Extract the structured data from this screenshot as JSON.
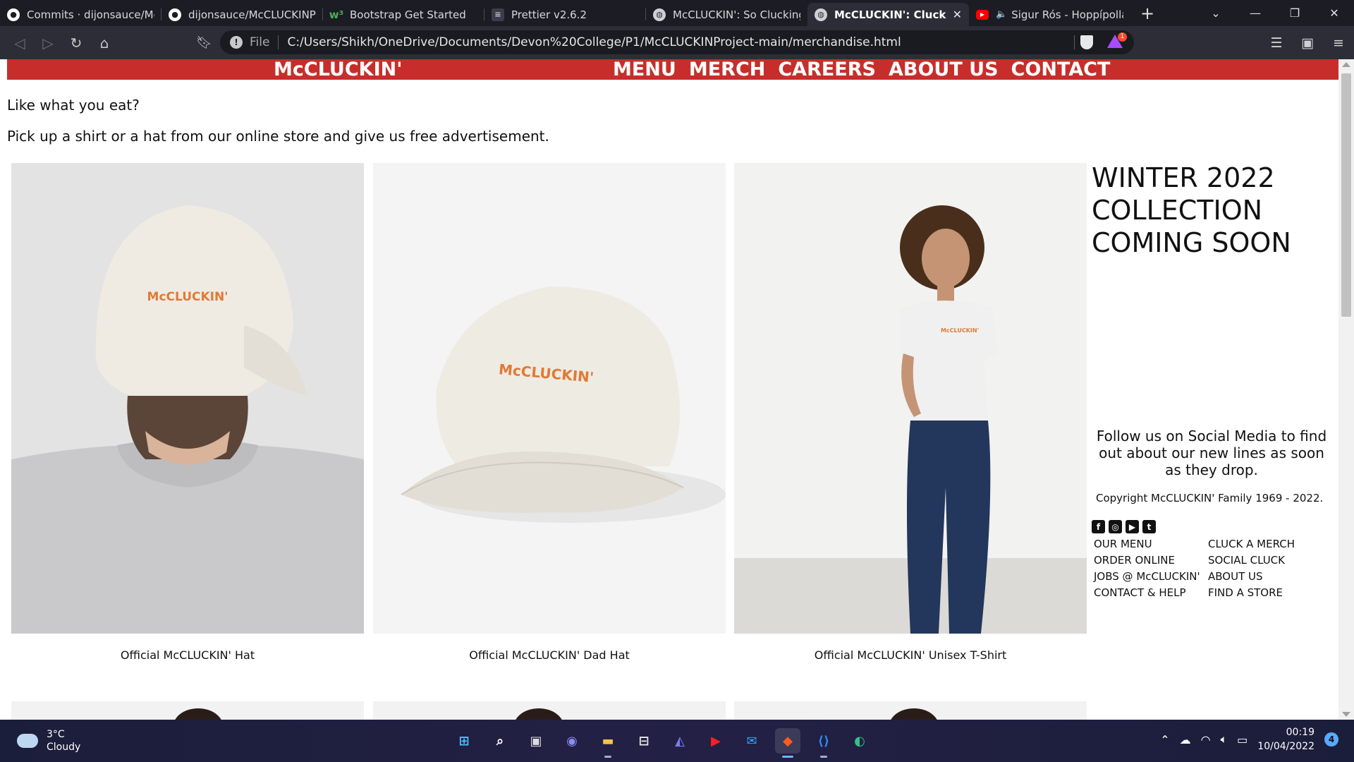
{
  "browser": {
    "tabs": [
      {
        "title": "Commits · dijonsauce/McCl",
        "icon": "github-icon"
      },
      {
        "title": "dijonsauce/McCLUCKINPro",
        "icon": "github-icon"
      },
      {
        "title": "Bootstrap Get Started",
        "icon": "w3schools-icon"
      },
      {
        "title": "Prettier v2.6.2",
        "icon": "prettier-icon"
      },
      {
        "title": "McCLUCKIN': So Clucking G",
        "icon": "globe-icon"
      },
      {
        "title": "McCLUCKIN': Cluck A M",
        "icon": "globe-icon"
      },
      {
        "title": "Sigur Rós - Hoppípolla",
        "icon": "youtube-icon"
      }
    ],
    "active_tab_index": 5,
    "address": {
      "scheme_label": "File",
      "url": "C:/Users/Shikh/OneDrive/Documents/Devon%20College/P1/McCLUCKINProject-main/merchandise.html"
    },
    "rewards_badge": "1"
  },
  "site": {
    "brand": "McCLUCKIN'",
    "nav": [
      "MENU",
      "MERCH",
      "CAREERS",
      "ABOUT US",
      "CONTACT"
    ],
    "intro_line1": "Like what you eat?",
    "intro_line2": "Pick up a shirt or a hat from our online store and give us free advertisement.",
    "products": [
      {
        "caption": "Official McCLUCKIN' Hat",
        "print": "McCLUCKIN'"
      },
      {
        "caption": "Official McCLUCKIN' Dad Hat",
        "print": "McCLUCKIN'"
      },
      {
        "caption": "Official McCLUCKIN' Unisex T-Shirt",
        "print": "McCLUCKIN'"
      }
    ],
    "sidebar": {
      "headline": "WINTER 2022 COLLECTION COMING SOON",
      "follow": "Follow us on Social Media to find out about our new lines as soon as they drop.",
      "copyright": "Copyright McCLUCKIN' Family 1969 - 2022.",
      "social_icons": [
        "facebook-icon",
        "instagram-icon",
        "youtube-icon",
        "twitter-icon"
      ],
      "links": [
        "OUR MENU",
        "CLUCK A MERCH",
        "ORDER ONLINE",
        "SOCIAL CLUCK",
        "JOBS @ McCLUCKIN'",
        "ABOUT US",
        "CONTACT & HELP",
        "FIND A STORE"
      ]
    },
    "colors": {
      "brand_red": "#c72e2b",
      "logo_orange": "#e07a36"
    }
  },
  "taskbar": {
    "weather_temp": "3°C",
    "weather_desc": "Cloudy",
    "time": "00:19",
    "date": "10/04/2022",
    "notifications": "4",
    "apps": [
      "start-icon",
      "search-icon",
      "task-view-icon",
      "teams-chat-icon",
      "file-explorer-icon",
      "microsoft-store-icon",
      "visual-studio-icon",
      "youtube-icon",
      "mail-icon",
      "brave-icon",
      "vscode-icon",
      "edge-icon"
    ]
  }
}
